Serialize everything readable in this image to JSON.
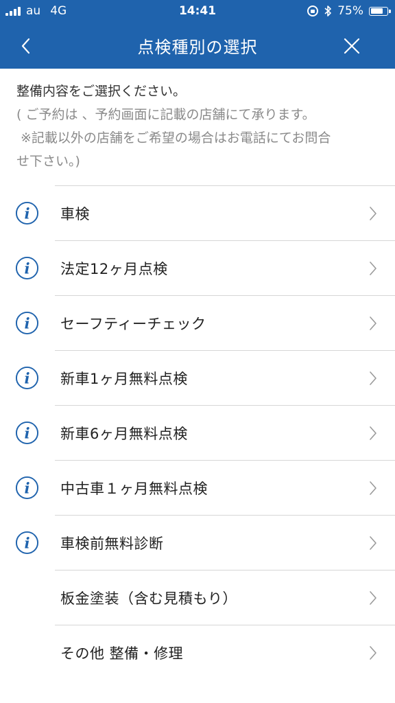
{
  "status_bar": {
    "carrier": "au",
    "network": "4G",
    "time": "14:41",
    "battery": "75%",
    "battery_level": 0.75
  },
  "navbar": {
    "title": "点検種別の選択",
    "back_icon": "chevron-left-icon",
    "close_icon": "close-icon"
  },
  "intro": {
    "line1": "整備内容をご選択ください。",
    "line2": "( ご予約は 、予約画面に記載の店舗にて承ります。",
    "line3": "※記載以外の店舗をご希望の場合はお電話にてお問合",
    "line4": "せ下さい。)"
  },
  "items": [
    {
      "label": "車検",
      "has_info": true
    },
    {
      "label": "法定12ヶ月点検",
      "has_info": true
    },
    {
      "label": "セーフティーチェック",
      "has_info": true
    },
    {
      "label": "新車1ヶ月無料点検",
      "has_info": true
    },
    {
      "label": "新車6ヶ月無料点検",
      "has_info": true
    },
    {
      "label": "中古車１ヶ月無料点検",
      "has_info": true
    },
    {
      "label": "車検前無料診断",
      "has_info": true
    },
    {
      "label": "板金塗装（含む見積もり）",
      "has_info": false
    },
    {
      "label": "その他 整備・修理",
      "has_info": false
    }
  ],
  "colors": {
    "header": "#1f63ad",
    "info_icon": "#1f63ad",
    "chevron": "#9a9a9a"
  }
}
